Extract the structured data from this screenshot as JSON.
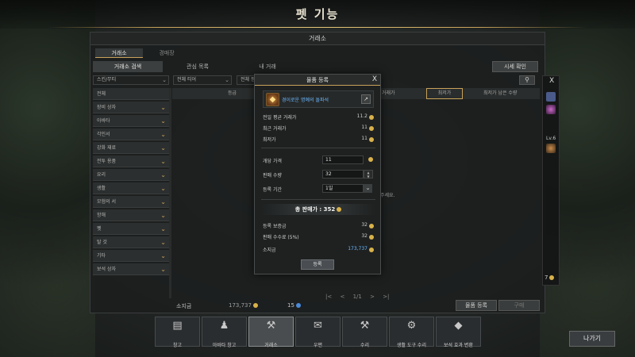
{
  "title": "펫 기능",
  "window": {
    "header": "거래소",
    "mode_tabs": [
      "거래소",
      "경매장"
    ],
    "sub_tabs": [
      "거래소 검색",
      "관심 목록",
      "내 거래"
    ],
    "market_check_btn": "시세 확인"
  },
  "filters": {
    "category": "스킨/무티",
    "tier": "전체 티어",
    "grade": "전체 등",
    "search_icon": "search-icon"
  },
  "categories": [
    "전체",
    "장비 상자",
    "아바타",
    "각인서",
    "강화 재료",
    "전투 용품",
    "요리",
    "생활",
    "모험의 서",
    "항해",
    "펫",
    "탈 것",
    "기타",
    "보석 상자"
  ],
  "results": {
    "columns": [
      "등급",
      "거래가",
      "최저가",
      "최저가 남은 수량"
    ],
    "note": "주세요."
  },
  "pagination": {
    "first": "|<",
    "prev": "<",
    "page": "1/1",
    "next": ">",
    "last": ">|"
  },
  "footer": {
    "gold_label": "소지금",
    "gold": "173,737",
    "crystal": "15",
    "register_btn": "물품 등록",
    "buy_btn": "구매"
  },
  "side_panel": {
    "close": "X",
    "level": "Lv.6",
    "number": "7"
  },
  "dialog": {
    "title": "물품 등록",
    "close": "X",
    "item_name": "경이로운 명예의 돌파석",
    "stats": [
      {
        "label": "전일 평균 거래가",
        "value": "11.2"
      },
      {
        "label": "최근 거래가",
        "value": "11"
      },
      {
        "label": "최저가",
        "value": "11"
      }
    ],
    "price_label": "개당 가격",
    "price_value": "11",
    "qty_label": "판매 수량",
    "qty_value": "32",
    "period_label": "등록 기간",
    "period_value": "1일",
    "total": "총 판매가 : 352",
    "fees": [
      {
        "label": "등록 보증금",
        "value": "32"
      },
      {
        "label": "판매 수수료 (5%)",
        "value": "32"
      },
      {
        "label": "소지금",
        "value": "173,737"
      }
    ],
    "register_btn": "등록"
  },
  "bottom_menu": [
    {
      "label": "창고",
      "icon": "warehouse-icon"
    },
    {
      "label": "아바타 창고",
      "icon": "avatar-storage-icon"
    },
    {
      "label": "거래소",
      "icon": "gavel-icon"
    },
    {
      "label": "우편",
      "icon": "mail-icon"
    },
    {
      "label": "수리",
      "icon": "anvil-icon"
    },
    {
      "label": "생활 도구 수리",
      "icon": "tool-repair-icon"
    },
    {
      "label": "보석 효과 변환",
      "icon": "gem-convert-icon"
    }
  ],
  "exit_btn": "나가기",
  "colors": {
    "accent_gold": "#c9a25a",
    "item_blue": "#6bb8ff",
    "coin": "#d9b24a"
  }
}
